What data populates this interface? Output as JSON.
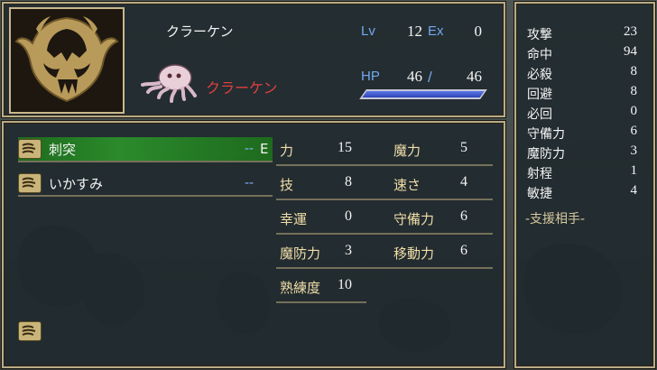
{
  "unit": {
    "name": "クラーケン",
    "class": "クラーケン",
    "lv_label": "Lv",
    "lv": "12",
    "ex_label": "Ex",
    "ex": "0",
    "hp_label": "HP",
    "hp_current": "46",
    "hp_sep": "/",
    "hp_max": "46",
    "hp_fraction": 1.0
  },
  "side_stats": [
    {
      "label": "攻撃",
      "value": "23"
    },
    {
      "label": "命中",
      "value": "94"
    },
    {
      "label": "必殺",
      "value": "8"
    },
    {
      "label": "回避",
      "value": "8"
    },
    {
      "label": "必回",
      "value": "0"
    },
    {
      "label": "守備力",
      "value": "6"
    },
    {
      "label": "魔防力",
      "value": "3"
    },
    {
      "label": "射程",
      "value": "1"
    },
    {
      "label": "敏捷",
      "value": "4"
    }
  ],
  "support_label": "-支援相手-",
  "items": [
    {
      "name": "刺突",
      "uses": "--",
      "equipped": "E"
    },
    {
      "name": "いかすみ",
      "uses": "--",
      "equipped": ""
    }
  ],
  "params_left": [
    {
      "label": "力",
      "value": "15"
    },
    {
      "label": "技",
      "value": "8"
    },
    {
      "label": "幸運",
      "value": "0"
    },
    {
      "label": "魔防力",
      "value": "3"
    },
    {
      "label": "熟練度",
      "value": "10"
    }
  ],
  "params_right": [
    {
      "label": "魔力",
      "value": "5"
    },
    {
      "label": "速さ",
      "value": "4"
    },
    {
      "label": "守備力",
      "value": "6"
    },
    {
      "label": "移動力",
      "value": "6"
    }
  ],
  "icons": {
    "portrait": "kraken-portrait-icon",
    "sprite": "kraken-sprite-icon",
    "item": "claw-icon"
  },
  "colors": {
    "accent_blue": "#72a8f0",
    "frame_gold": "#b8ab86",
    "selected_green": "#2b8a2b",
    "hp_fill": "#3e5ad0",
    "class_red": "#e04040"
  }
}
